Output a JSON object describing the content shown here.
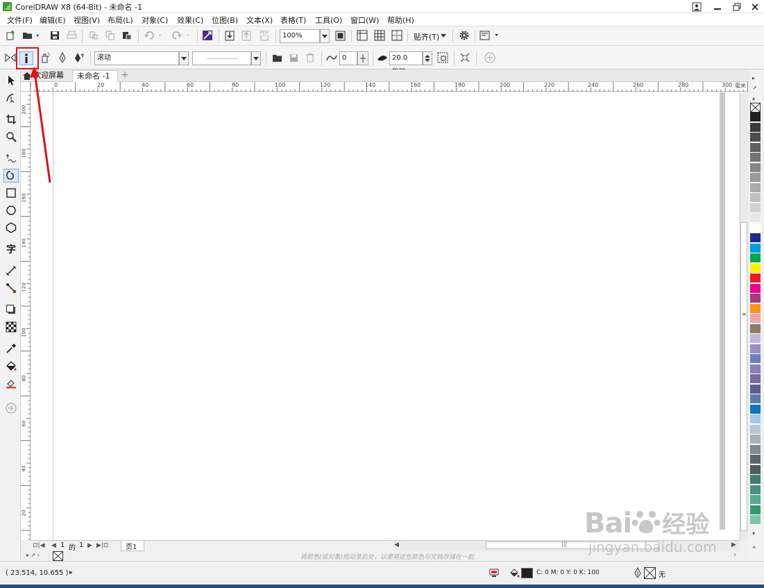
{
  "window": {
    "title": "CorelDRAW X8 (64-Bit) - 未命名 -1"
  },
  "menu": [
    "文件(F)",
    "编辑(E)",
    "视图(V)",
    "布局(L)",
    "对象(C)",
    "效果(C)",
    "位图(B)",
    "文本(X)",
    "表格(T)",
    "工具(O)",
    "窗口(W)",
    "帮助(H)"
  ],
  "toolbar": {
    "zoom": "100%",
    "snap": "贴齐(T)",
    "pdf_label": "PDF"
  },
  "propbar": {
    "mode_value": "滚动",
    "smoothness": "0",
    "width": "20.0 mm"
  },
  "tabs": {
    "welcome": "欢迎屏幕",
    "doc": "未命名 -1",
    "add": "+"
  },
  "ruler": {
    "h_ticks": [
      "20",
      "0",
      "20",
      "40",
      "60",
      "80",
      "100",
      "120",
      "140",
      "160",
      "180",
      "200",
      "220",
      "240",
      "260",
      "280",
      "300"
    ],
    "h_unit": "毫米",
    "v_ticks": [
      "200",
      "180",
      "160",
      "140",
      "120",
      "100",
      "80",
      "60",
      "40",
      "20"
    ]
  },
  "pagenav": {
    "current": "1",
    "of": "的",
    "total": "1",
    "page_tab": "页1"
  },
  "docpalette_hint": "将颜色(或对象)拖动至此处，以便将这些颜色与文档存储在一起",
  "status": {
    "coords": "( 23.514, 10.655 )",
    "fill_info": "C: 0 M: 0 Y: 0 K: 100",
    "outline_info": "无"
  },
  "colors": {
    "accent_red": "#e01010",
    "palette": [
      "#231f20",
      "#3b3b3b",
      "#4d4d4d",
      "#606060",
      "#737373",
      "#868686",
      "#999999",
      "#acacac",
      "#bfbfbf",
      "#d2d2d2",
      "#e6e6e6",
      "#ffffff",
      "#1b2b8c",
      "#009ee0",
      "#00a650",
      "#fff200",
      "#ed1c24",
      "#ec008c",
      "#a8397a",
      "#f7941d",
      "#f5a3a3",
      "#8c7b6b",
      "#c3b6d8",
      "#9e8fc2",
      "#6d7ebf",
      "#8b7fb8",
      "#7a6aa8",
      "#5d5f8a",
      "#5b7da8",
      "#0f75bc",
      "#9fc9e8",
      "#b4c8d6",
      "#a6b3ba",
      "#7c8b94",
      "#5b6870",
      "#4a5a5d",
      "#3f7a70",
      "#4d8f82",
      "#5aa890",
      "#2f9b6c",
      "#7fc4a8"
    ]
  },
  "watermark": {
    "brand": "Bai",
    "brand2": "经验",
    "url": "jingyan.baidu.com"
  }
}
